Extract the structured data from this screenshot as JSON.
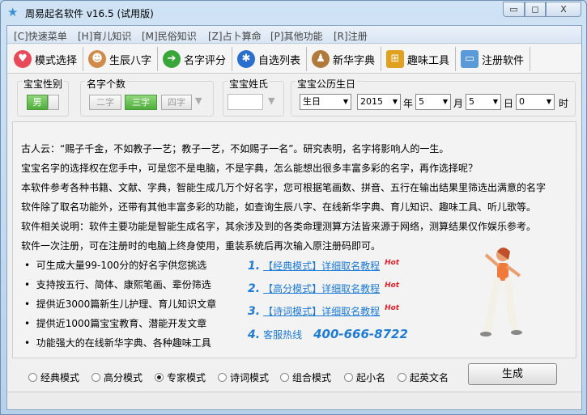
{
  "window": {
    "title": "周易起名软件 v16.5 (试用版)",
    "min": "▭",
    "max": "◻",
    "close": "X"
  },
  "menu": [
    "[C]快速菜单",
    "[H]育儿知识",
    "[M]民俗知识",
    "[Z]占卜算命",
    "[P]其他功能",
    "[R]注册"
  ],
  "toolbar": [
    {
      "label": "模式选择",
      "icon": "heart-icon",
      "color": "#e84a5a"
    },
    {
      "label": "生辰八字",
      "icon": "people-icon",
      "color": "#d08a4a"
    },
    {
      "label": "名字评分",
      "icon": "arrow-right-icon",
      "color": "#3aa63a"
    },
    {
      "label": "自选列表",
      "icon": "globe-icon",
      "color": "#2a6fd0"
    },
    {
      "label": "新华字典",
      "icon": "graduate-icon",
      "color": "#b07a3a"
    },
    {
      "label": "趣味工具",
      "icon": "windows-icon",
      "color": "#e0a020"
    },
    {
      "label": "注册软件",
      "icon": "monitor-icon",
      "color": "#5a9ad8"
    }
  ],
  "options": {
    "gender_label": "宝宝性别",
    "gender": "男",
    "count_label": "名字个数",
    "counts": [
      "二字",
      "三字",
      "四字"
    ],
    "count_selected": "三字",
    "surname_label": "宝宝姓氏",
    "surname": "",
    "birthday_label": "宝宝公历生日",
    "calendar": "生日",
    "year": "2015",
    "year_unit": "年",
    "month": "5",
    "month_unit": "月",
    "day": "5",
    "day_unit": "日",
    "hour": "0",
    "hour_unit": "时"
  },
  "intro": [
    "古人云：“赐子千金，不如教子一艺；教子一艺，不如赐子一名”。研究表明，名字将影响人的一生。",
    "宝宝名字的选择权在您手中，可是您不是电脑，不是字典，怎么能想出很多丰富多彩的名字，再作选择呢？",
    "本软件参考各种书籍、文献、字典，智能生成几万个好名字，您可根据笔画数、拼音、五行在输出结果里筛选出满意的名字",
    "软件除了取名功能外，还带有其他丰富多彩的功能，如查询生辰八字、在线新华字典、育儿知识、趣味工具、听儿歌等。",
    "软件相关说明：软件主要功能是智能生成名字，其余涉及到的各类命理测算方法皆来源于网络，测算结果仅作娱乐参考。",
    "软件一次注册，可在注册时的电脑上终身使用，重装系统后再次输入原注册码即可。"
  ],
  "features": [
    "可生成大量99-100分的好名字供您挑选",
    "支持按五行、简体、康熙笔画、辈份筛选",
    "提供近3000篇新生儿护理、育儿知识文章",
    "提供近1000篇宝宝教育、潜能开发文章",
    "功能强大的在线新华字典、各种趣味工具"
  ],
  "tutorials": [
    {
      "num": "1.",
      "label": "【经典模式】详细取名教程",
      "hot": "Hot"
    },
    {
      "num": "2.",
      "label": "【高分模式】详细取名教程",
      "hot": "Hot"
    },
    {
      "num": "3.",
      "label": "【诗词模式】详细取名教程",
      "hot": "Hot"
    }
  ],
  "hotline": {
    "num": "4.",
    "label": "客服热线",
    "phone": "400-666-8722"
  },
  "modes": [
    "经典模式",
    "高分模式",
    "专家模式",
    "诗词模式",
    "组合模式",
    "起小名",
    "起英文名"
  ],
  "mode_selected": "专家模式",
  "generate": "生成"
}
